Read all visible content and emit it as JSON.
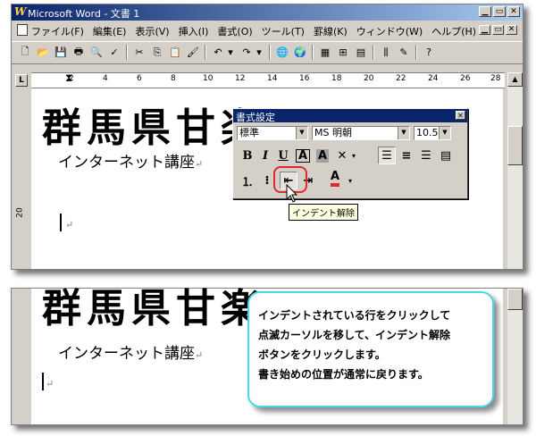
{
  "window": {
    "title": "Microsoft Word - 文書 1",
    "app_icon": "W"
  },
  "menu": [
    "ファイル(F)",
    "編集(E)",
    "表示(V)",
    "挿入(I)",
    "書式(O)",
    "ツール(T)",
    "罫線(K)",
    "ウィンドウ(W)",
    "ヘルプ(H)"
  ],
  "ruler": {
    "marks": [
      "2",
      "4",
      "6",
      "8",
      "10",
      "12",
      "14",
      "16",
      "18",
      "20",
      "22",
      "24",
      "26",
      "28"
    ],
    "left_box": "L"
  },
  "vruler": {
    "labels": [
      "20"
    ]
  },
  "document": {
    "heading": "群馬県甘楽",
    "line1": "インターネット講座",
    "return_mark": "↵"
  },
  "format_toolbar": {
    "title": "書式設定",
    "style": "標準",
    "font": "MS 明朝",
    "size": "10.5",
    "bold": "B",
    "italic": "I",
    "underline": "U",
    "char_border": "A",
    "char_shade": "A",
    "font_color": "A"
  },
  "tooltip": "インデント解除",
  "bottom_doc": {
    "heading": "群馬県甘楽",
    "line1": "インターネット講座",
    "return_mark": "↵"
  },
  "callout": {
    "lines": [
      "インデントされている行をクリックして",
      "点滅カーソルを移して、インデント解除",
      "ボタンをクリックします。",
      "書き始めの位置が通常に戻ります。"
    ]
  },
  "colors": {
    "title_bar": "#0a246a",
    "highlight": "#e0282c",
    "callout_border": "#49d8e6",
    "font_color_bar": "#e0282c"
  }
}
